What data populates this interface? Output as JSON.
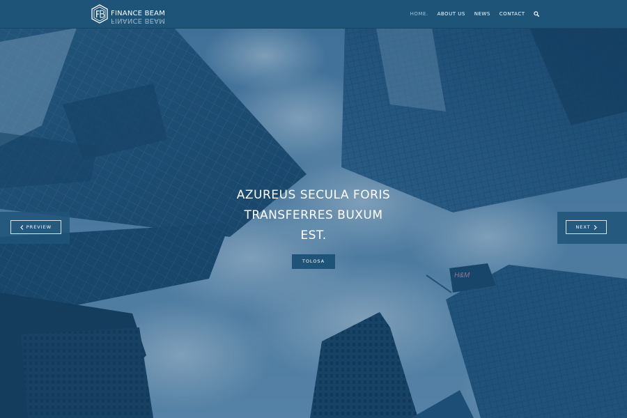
{
  "brand": {
    "name": "FINANCE BEAM",
    "logo_icon": "hexagon-letters-icon"
  },
  "nav": {
    "items": [
      {
        "label": "HOME.",
        "active": true
      },
      {
        "label": "ABOUT US",
        "active": false
      },
      {
        "label": "NEWS",
        "active": false
      },
      {
        "label": "CONTACT",
        "active": false
      }
    ],
    "search_icon": "search-icon"
  },
  "hero": {
    "title_line_1": "AZUREUS SECULA FORIS",
    "title_line_2": "TRANSFERRES BUXUM",
    "title_line_3": "EST.",
    "button_label": "TOLOSA",
    "prev_label": "PREVIEW",
    "next_label": "NEXT",
    "prev_icon": "chevron-left-icon",
    "next_icon": "chevron-right-icon",
    "sign_text": "H&M"
  },
  "colors": {
    "header_bg": "#1e5478",
    "accent": "#1e5478",
    "active_nav": "#9ec4dd",
    "overlay": "#123e64"
  }
}
